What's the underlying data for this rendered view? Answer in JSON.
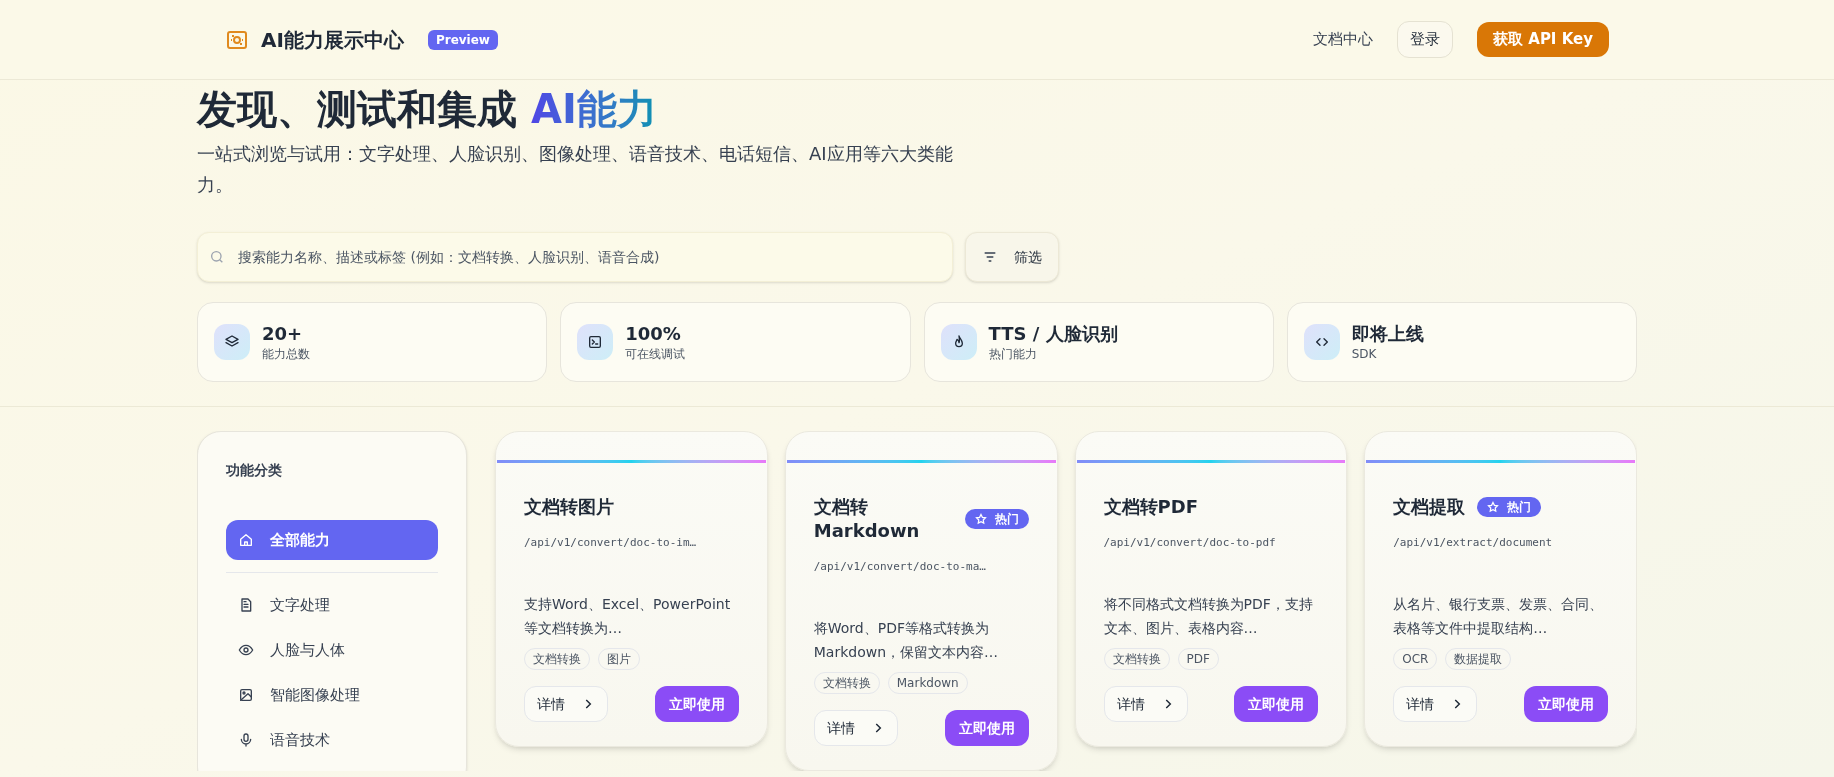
{
  "header": {
    "brand": "AI能力展示中心",
    "badge": "Preview",
    "nav": [
      {
        "label": "文档中心",
        "kind": "link"
      },
      {
        "label": "登录",
        "kind": "outline"
      },
      {
        "label": "获取 API Key",
        "kind": "primary"
      }
    ]
  },
  "hero": {
    "title": "发现、测试和集成",
    "title_highlight": "AI能力",
    "subtitle": "一站式浏览与试用：文字处理、人脸识别、图像处理、语音技术、电话短信、AI应用等六大类能力。"
  },
  "search": {
    "placeholder": "搜索能力名称、描述或标签 (例如：文档转换、人脸识别、语音合成)",
    "filter_label": "筛选"
  },
  "stats": [
    {
      "value": "20+",
      "label": "能力总数"
    },
    {
      "value": "100%",
      "label": "可在线调试"
    },
    {
      "value": "TTS / 人脸识别",
      "label": "热门能力"
    },
    {
      "value": "即将上线",
      "label": "SDK"
    }
  ],
  "sidebar": {
    "title": "功能分类",
    "items": [
      {
        "label": "全部能力",
        "selected": true
      },
      {
        "label": "文字处理",
        "selected": false
      },
      {
        "label": "人脸与人体",
        "selected": false
      },
      {
        "label": "智能图像处理",
        "selected": false
      },
      {
        "label": "语音技术",
        "selected": false
      }
    ]
  },
  "cards": [
    {
      "title": "文档转图片",
      "path": "/api/v1/convert/doc-to-im…",
      "description": "支持Word、Excel、PowerPoint等文档转换为…",
      "tags": [
        "文档转换",
        "图片"
      ],
      "details": "详情",
      "action": "立即使用"
    },
    {
      "title": "文档转Markdown",
      "badge": "热门",
      "path": "/api/v1/convert/doc-to-ma…",
      "description": "将Word、PDF等格式转换为Markdown，保留文本内容…",
      "tags": [
        "文档转换",
        "Markdown"
      ],
      "details": "详情",
      "action": "立即使用"
    },
    {
      "title": "文档转PDF",
      "path": "/api/v1/convert/doc-to-pdf",
      "description": "将不同格式文档转换为PDF，支持文本、图片、表格内容…",
      "tags": [
        "文档转换",
        "PDF"
      ],
      "details": "详情",
      "action": "立即使用"
    },
    {
      "title": "文档提取",
      "badge": "热门",
      "path": "/api/v1/extract/document",
      "description": "从名片、银行支票、发票、合同、表格等文件中提取结构…",
      "tags": [
        "OCR",
        "数据提取"
      ],
      "details": "详情",
      "action": "立即使用"
    }
  ]
}
